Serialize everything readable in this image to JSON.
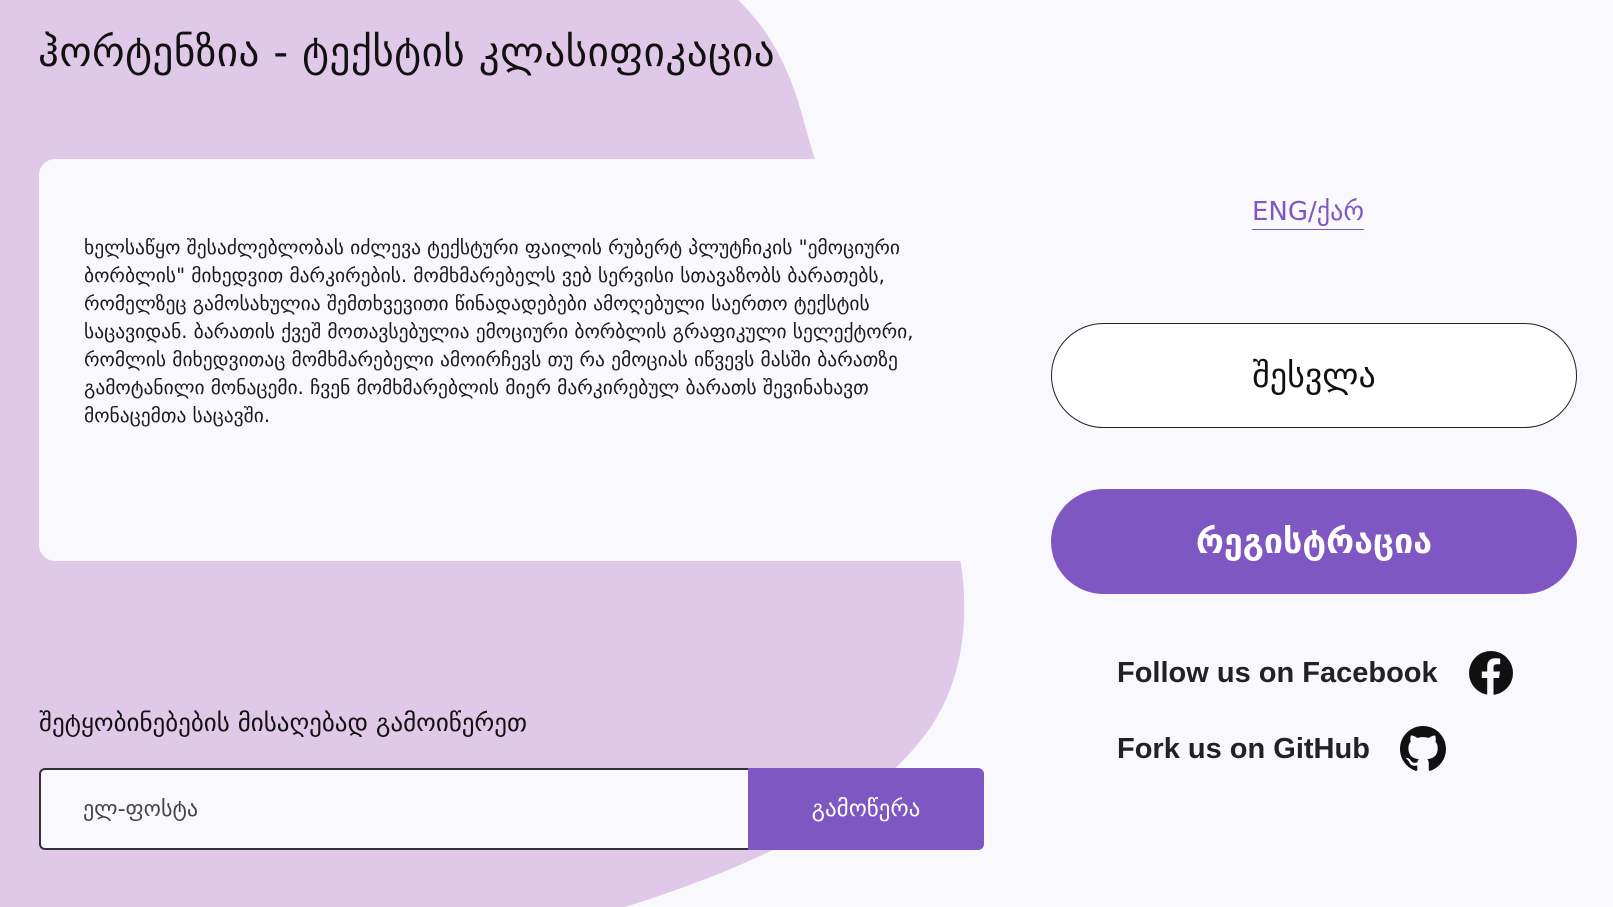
{
  "header": {
    "title": "ჰორტენზია - ტექსტის კლასიფიკაცია"
  },
  "about": {
    "text": "ხელსაწყო შესაძლებლობას იძლევა ტექსტური ფაილის რუბერტ პლუტჩიკის \"ემოციური ბორბლის\" მიხედვით მარკირების. მომხმარებელს ვებ სერვისი სთავაზობს ბარათებს, რომელზეც გამოსახულია შემთხვევითი წინადადებები ამოღებული საერთო ტექსტის საცავიდან. ბარათის ქვეშ მოთავსებულია ემოციური ბორბლის გრაფიკული სელექტორი, რომლის მიხედვითაც მომხმარებელი ამოირჩევს თუ რა ემოციას იწვევს მასში ბარათზე გამოტანილი მონაცემი. ჩვენ მომხმარებლის მიერ მარკირებულ ბარათს შევინახავთ მონაცემთა საცავში."
  },
  "newsletter": {
    "heading": "შეტყობინებების მისაღებად გამოიწერეთ",
    "email_placeholder": "ელ-ფოსტა",
    "email_value": "",
    "subscribe_label": "გამოწერა"
  },
  "auth": {
    "language_toggle": "ENG/ქარ",
    "login_label": "შესვლა",
    "register_label": "რეგისტრაცია"
  },
  "social": {
    "facebook": {
      "label": "Follow us on Facebook",
      "icon": "facebook-icon"
    },
    "github": {
      "label": "Fork us on GitHub",
      "icon": "github-icon"
    }
  },
  "colors": {
    "accent": "#7e57c2",
    "blob": "#dfc8e8",
    "background": "#f9f8fc",
    "card": "#f9f8fc",
    "text": "#111111"
  }
}
